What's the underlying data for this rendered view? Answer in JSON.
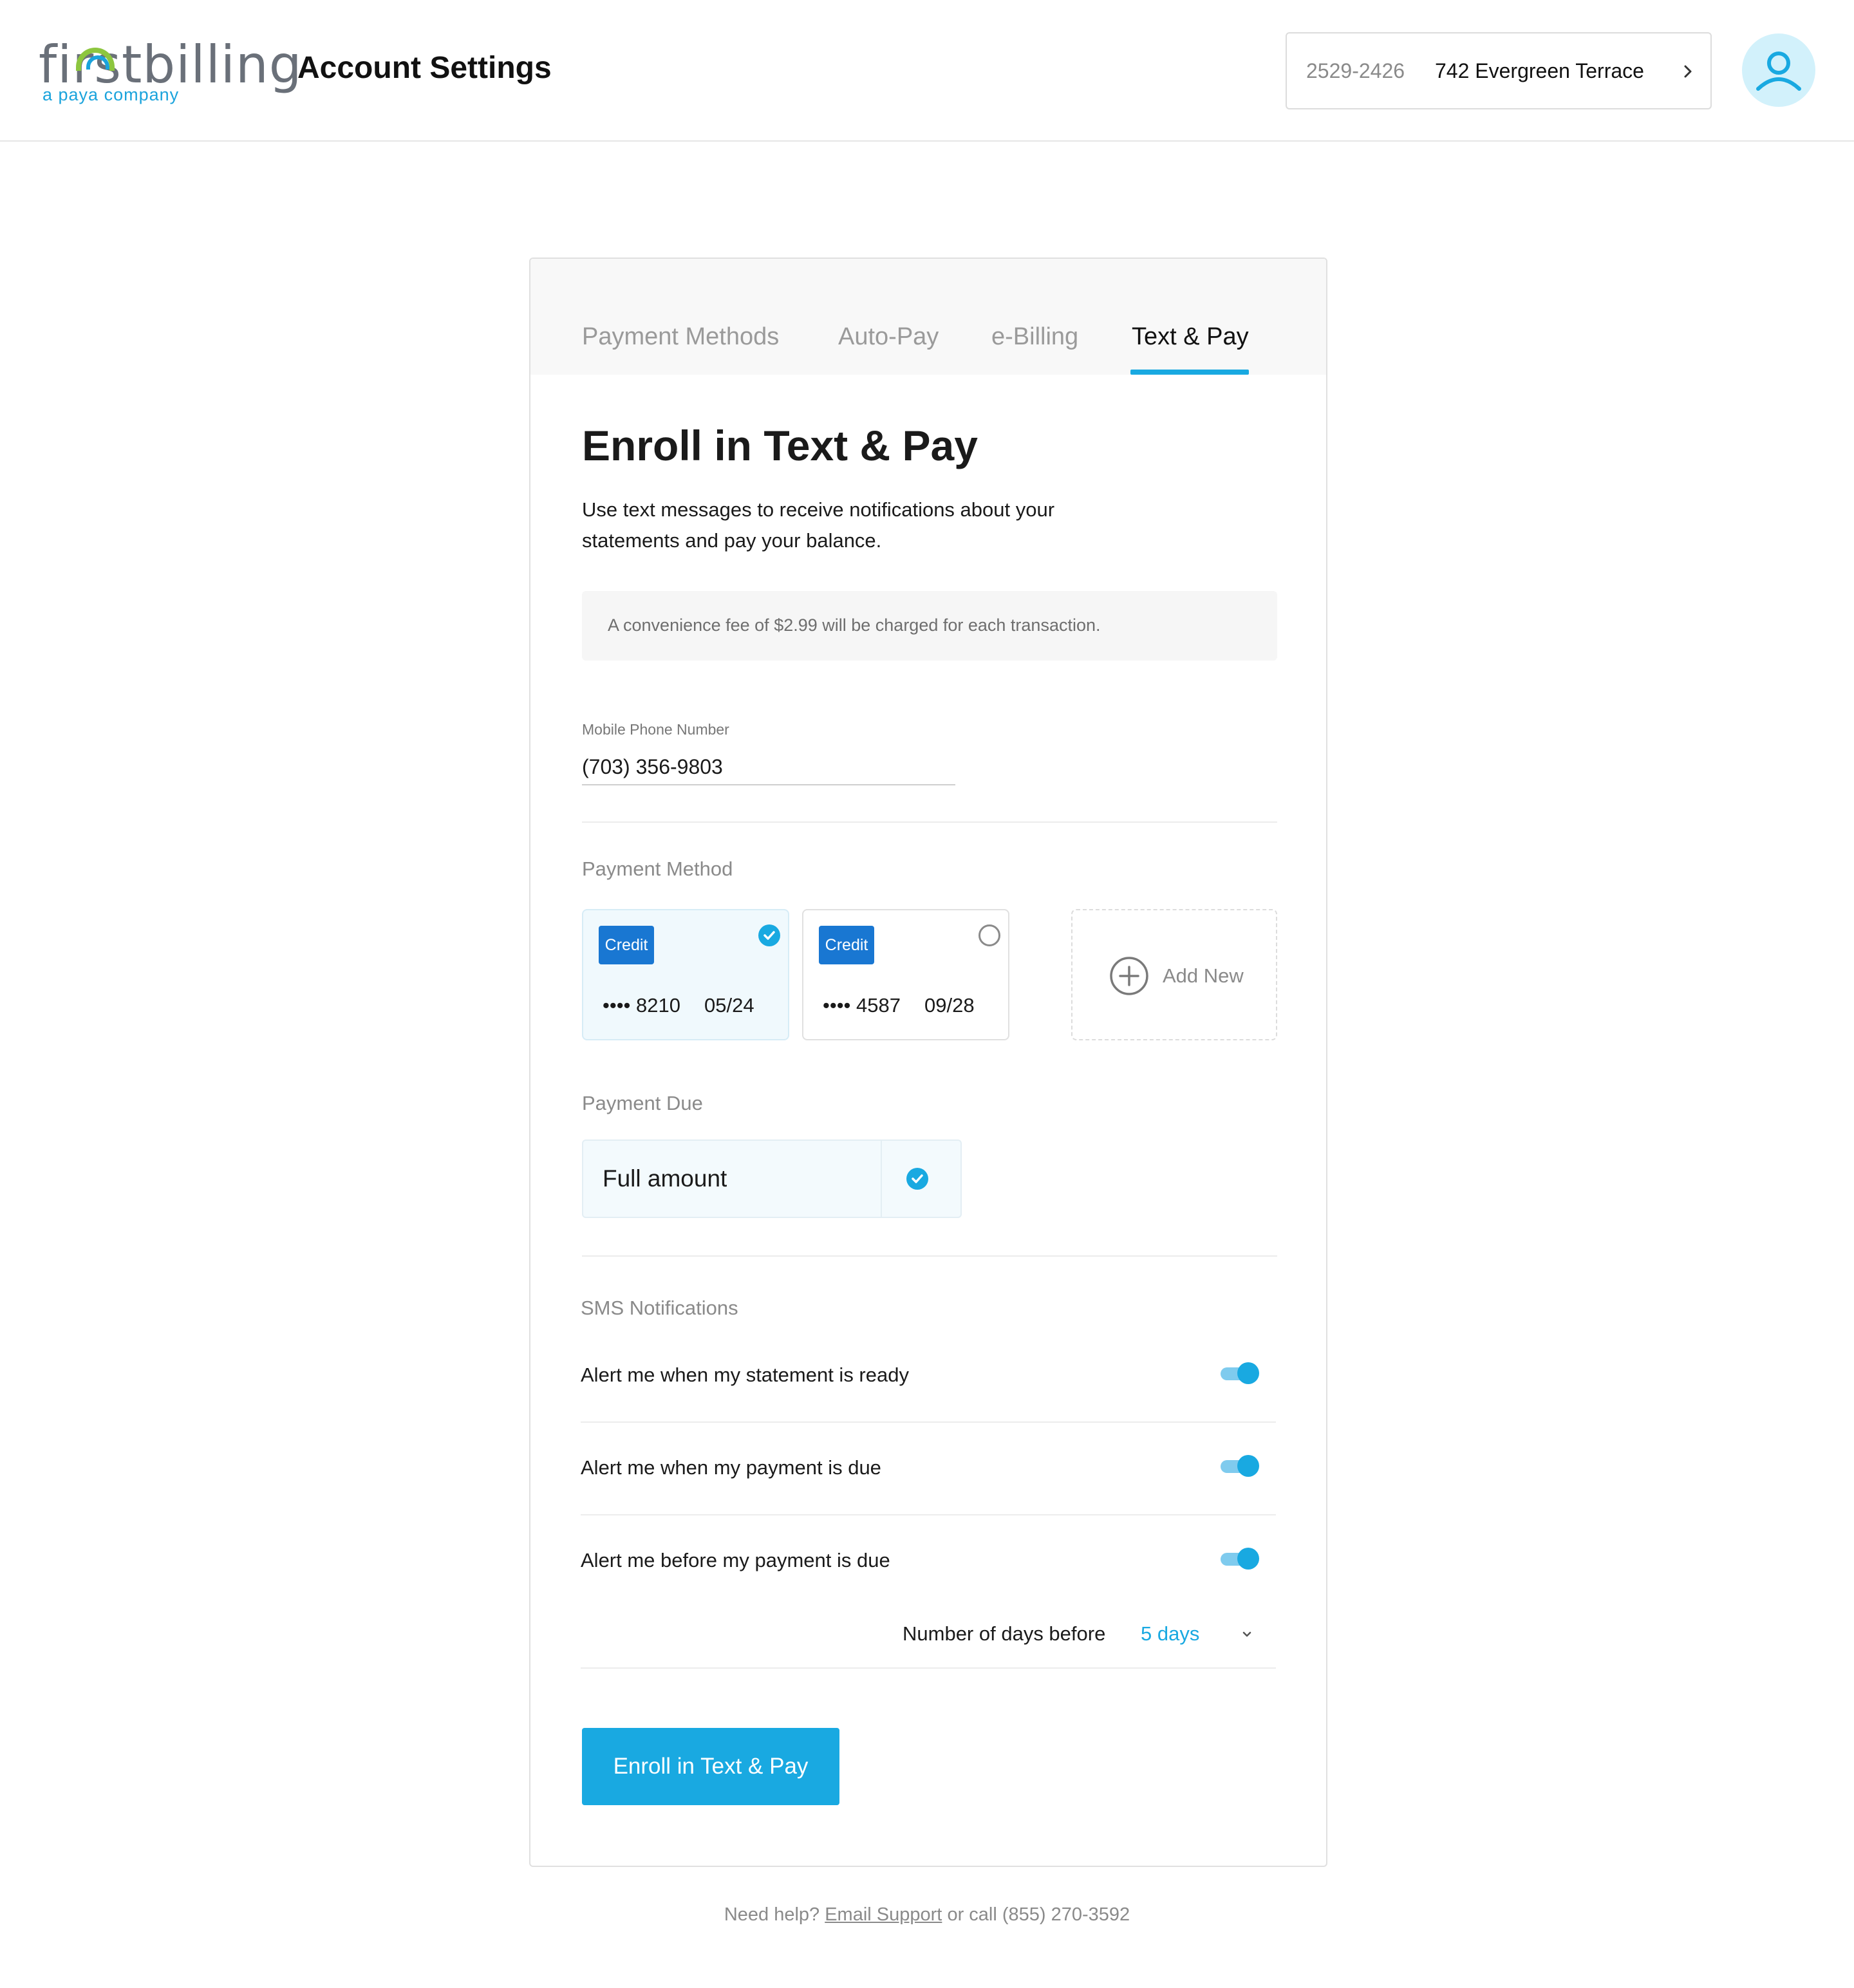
{
  "header": {
    "logo_main": "firstbilling",
    "logo_sub": "a paya company",
    "page_title": "Account Settings",
    "account_number": "2529-2426",
    "account_address": "742 Evergreen Terrace"
  },
  "tabs": [
    {
      "label": "Payment Methods",
      "active": false
    },
    {
      "label": "Auto-Pay",
      "active": false
    },
    {
      "label": "e-Billing",
      "active": false
    },
    {
      "label": "Text & Pay",
      "active": true
    }
  ],
  "enroll": {
    "heading": "Enroll in Text & Pay",
    "intro": "Use text messages to receive notifications about your statements and pay your balance.",
    "fee_notice": "A convenience fee of $2.99 will be charged for each transaction."
  },
  "phone": {
    "label": "Mobile Phone Number",
    "value": "(703) 356-9803"
  },
  "payment_method": {
    "label": "Payment Method",
    "cards": [
      {
        "type": "Credit",
        "masked": "•••• 8210",
        "expiry": "05/24",
        "selected": true
      },
      {
        "type": "Credit",
        "masked": "•••• 4587",
        "expiry": "09/28",
        "selected": false
      }
    ],
    "add_new_label": "Add New"
  },
  "payment_due": {
    "label": "Payment Due",
    "option": "Full amount",
    "selected": true
  },
  "sms": {
    "label": "SMS Notifications",
    "alerts": [
      {
        "text": "Alert me when my statement is ready",
        "enabled": true
      },
      {
        "text": "Alert me when my payment is due",
        "enabled": true
      },
      {
        "text": "Alert me before my payment is due",
        "enabled": true
      }
    ],
    "days_before_label": "Number of days before",
    "days_before_value": "5 days"
  },
  "actions": {
    "enroll_button": "Enroll in Text & Pay"
  },
  "footer": {
    "prefix": "Need help?",
    "link": "Email Support",
    "suffix": "or call (855) 270-3592"
  },
  "colors": {
    "accent": "#19a9e1",
    "badge": "#1977d2",
    "logo_green": "#8dc63f",
    "selected_bg": "#f0f9fd"
  }
}
